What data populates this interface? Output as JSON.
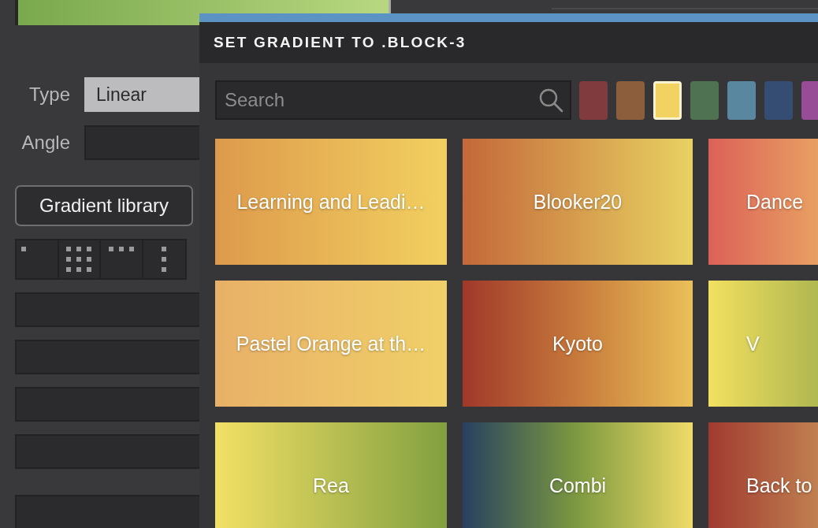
{
  "properties": {
    "type": {
      "label": "Type",
      "value": "Linear"
    },
    "angle": {
      "label": "Angle"
    },
    "library_button": "Gradient library",
    "layout_options": [
      {
        "kind": "dot"
      },
      {
        "kind": "grid"
      },
      {
        "kind": "row"
      },
      {
        "kind": "column"
      }
    ]
  },
  "dialog": {
    "title": "SET GRADIENT TO .BLOCK-3",
    "search": {
      "placeholder": "Search"
    },
    "swatches": [
      {
        "color": "#7f3b3e",
        "selected": false
      },
      {
        "color": "#8c5e3c",
        "selected": false
      },
      {
        "color": "#f2d260",
        "selected": true
      },
      {
        "color": "#4f7352",
        "selected": false
      },
      {
        "color": "#5a87a0",
        "selected": false
      },
      {
        "color": "#364d73",
        "selected": false
      },
      {
        "color": "#984c97",
        "selected": false
      }
    ],
    "gradients": [
      {
        "name": "Learning and Leadi…"
      },
      {
        "name": "Blooker20"
      },
      {
        "name": "Dance"
      },
      {
        "name": "Pastel Orange at th…"
      },
      {
        "name": "Kyoto"
      },
      {
        "name": "V"
      },
      {
        "name": "Rea"
      },
      {
        "name": "Combi"
      },
      {
        "name": "Back to"
      }
    ]
  }
}
